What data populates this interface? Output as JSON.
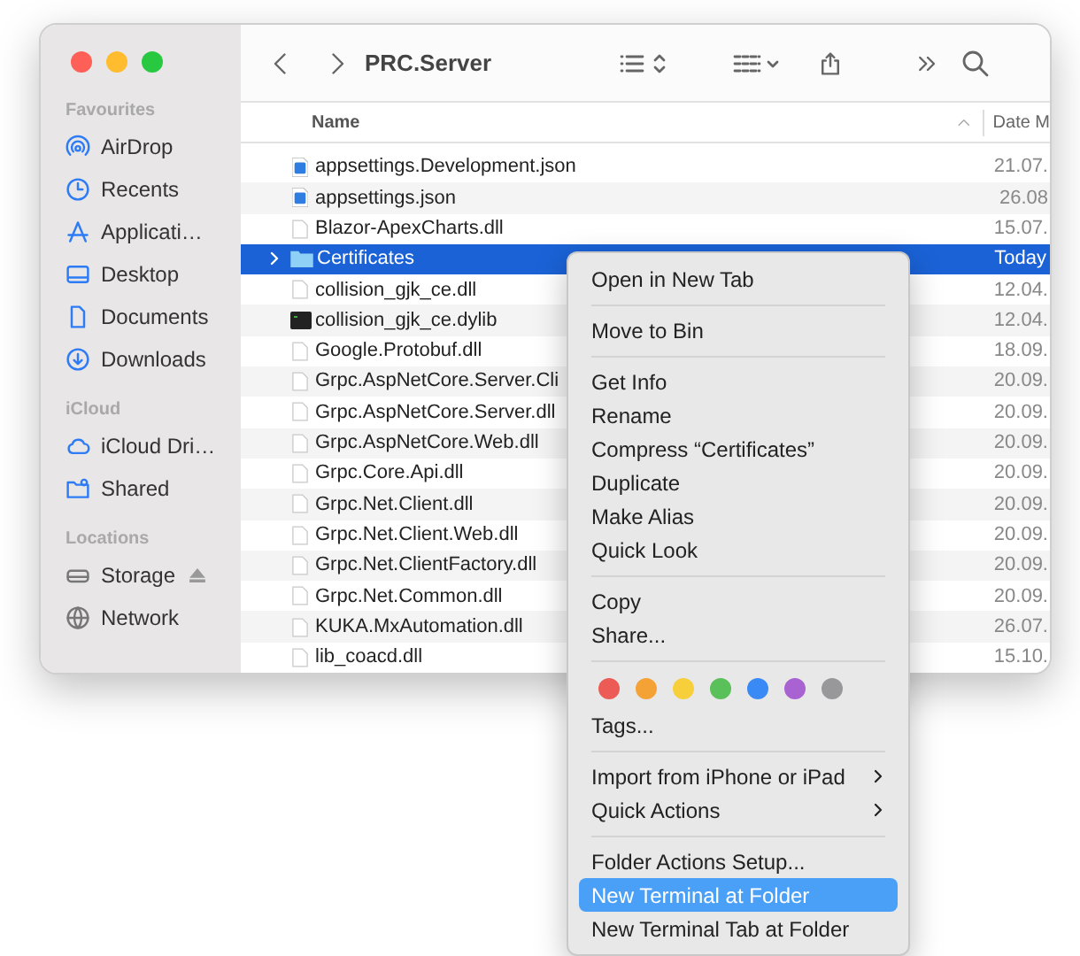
{
  "window": {
    "title": "PRC.Server"
  },
  "sidebar": {
    "sections": [
      {
        "heading": "Favourites",
        "items": [
          {
            "label": "AirDrop",
            "kind": "airdrop"
          },
          {
            "label": "Recents",
            "kind": "recents"
          },
          {
            "label": "Applicati…",
            "kind": "apps"
          },
          {
            "label": "Desktop",
            "kind": "desktop"
          },
          {
            "label": "Documents",
            "kind": "documents"
          },
          {
            "label": "Downloads",
            "kind": "downloads"
          }
        ]
      },
      {
        "heading": "iCloud",
        "items": [
          {
            "label": "iCloud Dri…",
            "kind": "cloud"
          },
          {
            "label": "Shared",
            "kind": "shared"
          }
        ]
      },
      {
        "heading": "Locations",
        "items": [
          {
            "label": "Storage",
            "kind": "disk"
          },
          {
            "label": "Network",
            "kind": "network"
          }
        ]
      }
    ]
  },
  "table": {
    "columns": [
      "Name",
      "Date M"
    ],
    "rows": [
      {
        "name": "appsettings.Development.json",
        "date": "21.07.",
        "kind": "json",
        "selected": false
      },
      {
        "name": "appsettings.json",
        "date": "26.08",
        "kind": "json",
        "selected": false
      },
      {
        "name": "Blazor-ApexCharts.dll",
        "date": "15.07.",
        "kind": "file",
        "selected": false
      },
      {
        "name": "Certificates",
        "date": "Today",
        "kind": "folder",
        "selected": true
      },
      {
        "name": "collision_gjk_ce.dll",
        "date": "12.04.",
        "kind": "file",
        "selected": false
      },
      {
        "name": "collision_gjk_ce.dylib",
        "date": "12.04.",
        "kind": "exec",
        "selected": false
      },
      {
        "name": "Google.Protobuf.dll",
        "date": "18.09.",
        "kind": "file",
        "selected": false
      },
      {
        "name": "Grpc.AspNetCore.Server.Cli",
        "date": "20.09.",
        "kind": "file",
        "selected": false
      },
      {
        "name": "Grpc.AspNetCore.Server.dll",
        "date": "20.09.",
        "kind": "file",
        "selected": false
      },
      {
        "name": "Grpc.AspNetCore.Web.dll",
        "date": "20.09.",
        "kind": "file",
        "selected": false
      },
      {
        "name": "Grpc.Core.Api.dll",
        "date": "20.09.",
        "kind": "file",
        "selected": false
      },
      {
        "name": "Grpc.Net.Client.dll",
        "date": "20.09.",
        "kind": "file",
        "selected": false
      },
      {
        "name": "Grpc.Net.Client.Web.dll",
        "date": "20.09.",
        "kind": "file",
        "selected": false
      },
      {
        "name": "Grpc.Net.ClientFactory.dll",
        "date": "20.09.",
        "kind": "file",
        "selected": false
      },
      {
        "name": "Grpc.Net.Common.dll",
        "date": "20.09.",
        "kind": "file",
        "selected": false
      },
      {
        "name": "KUKA.MxAutomation.dll",
        "date": "26.07.",
        "kind": "file",
        "selected": false
      },
      {
        "name": "lib_coacd.dll",
        "date": "15.10.",
        "kind": "file",
        "selected": false
      }
    ]
  },
  "context_menu": {
    "sections": [
      [
        {
          "kind": "item",
          "label": "Open in New Tab",
          "selected": false,
          "submenu": false
        }
      ],
      [
        {
          "kind": "item",
          "label": "Move to Bin",
          "selected": false,
          "submenu": false
        }
      ],
      [
        {
          "kind": "item",
          "label": "Get Info",
          "selected": false,
          "submenu": false
        },
        {
          "kind": "item",
          "label": "Rename",
          "selected": false,
          "submenu": false
        },
        {
          "kind": "item",
          "label": "Compress “Certificates”",
          "selected": false,
          "submenu": false
        },
        {
          "kind": "item",
          "label": "Duplicate",
          "selected": false,
          "submenu": false
        },
        {
          "kind": "item",
          "label": "Make Alias",
          "selected": false,
          "submenu": false
        },
        {
          "kind": "item",
          "label": "Quick Look",
          "selected": false,
          "submenu": false
        }
      ],
      [
        {
          "kind": "item",
          "label": "Copy",
          "selected": false,
          "submenu": false
        },
        {
          "kind": "item",
          "label": "Share...",
          "selected": false,
          "submenu": false
        }
      ],
      [
        {
          "kind": "tags",
          "colors": [
            {
              "color": "#ec5b55"
            },
            {
              "color": "#f4a235"
            },
            {
              "color": "#f6cf3a"
            },
            {
              "color": "#5ac05a"
            },
            {
              "color": "#3a8af5"
            },
            {
              "color": "#a862d2"
            },
            {
              "color": "#98989a"
            }
          ]
        },
        {
          "kind": "item",
          "label": "Tags...",
          "selected": false,
          "submenu": false
        }
      ],
      [
        {
          "kind": "item",
          "label": "Import from iPhone or iPad",
          "selected": false,
          "submenu": true
        },
        {
          "kind": "item",
          "label": "Quick Actions",
          "selected": false,
          "submenu": true
        }
      ],
      [
        {
          "kind": "item",
          "label": "Folder Actions Setup...",
          "selected": false,
          "submenu": false
        },
        {
          "kind": "item",
          "label": "New Terminal at Folder",
          "selected": true,
          "submenu": false
        },
        {
          "kind": "item",
          "label": "New Terminal Tab at Folder",
          "selected": false,
          "submenu": false
        }
      ]
    ]
  }
}
